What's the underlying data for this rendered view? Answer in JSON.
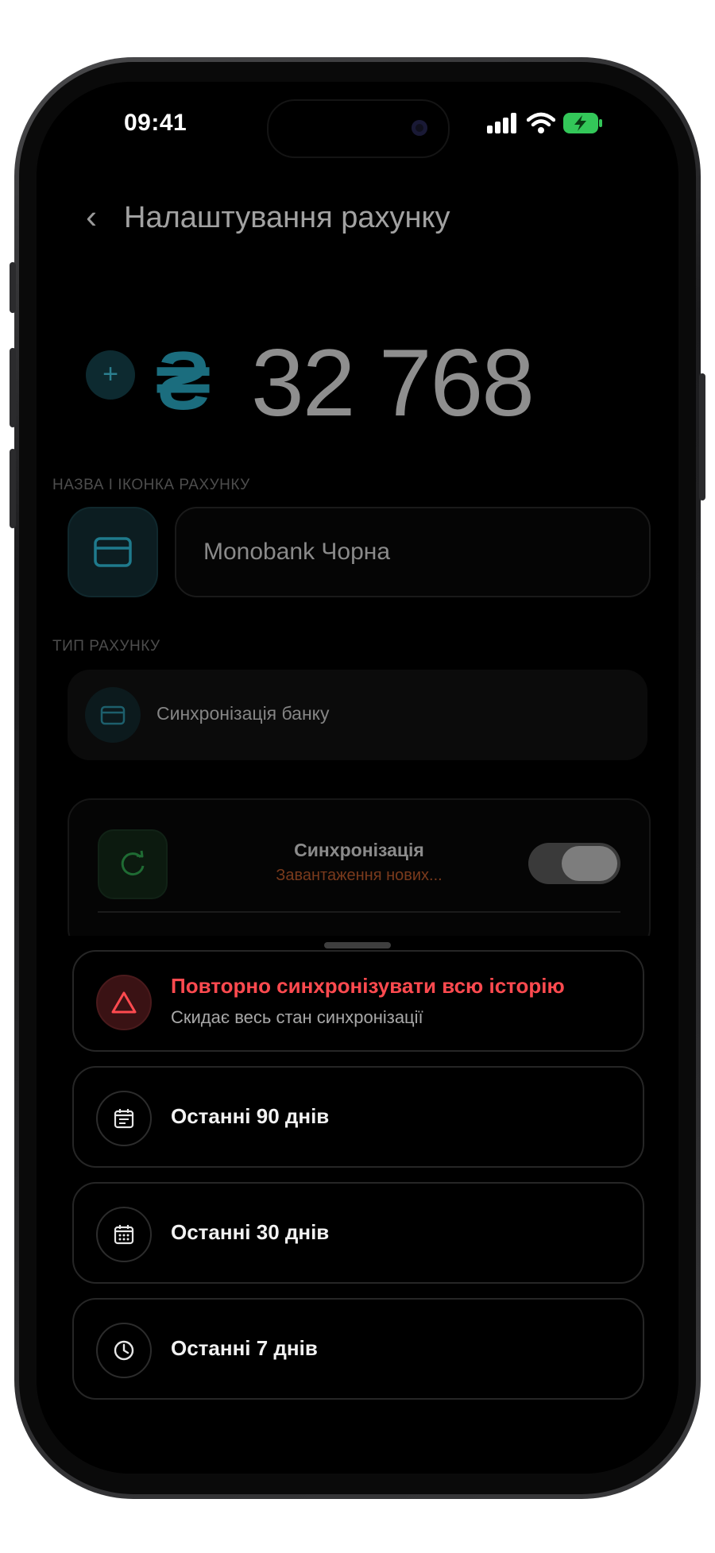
{
  "status": {
    "time": "09:41"
  },
  "header": {
    "title": "Налаштування рахунку"
  },
  "balance": {
    "currency": "₴",
    "amount": "32 768"
  },
  "name_section": {
    "label": "НАЗВА І ІКОНКА РАХУНКУ",
    "value": "Monobank Чорна"
  },
  "type_section": {
    "label": "ТИП РАХУНКУ",
    "value": "Синхронізація банку"
  },
  "sync": {
    "title": "Синхронізація",
    "status": "Завантаження нових...",
    "enabled": true
  },
  "sheet": {
    "options": [
      {
        "label": "Повторно синхронізувати всю історію",
        "sublabel": "Скидає весь стан синхронізації",
        "icon": "warning-triangle-icon"
      },
      {
        "label": "Останні 90 днів",
        "icon": "calendar-list-icon"
      },
      {
        "label": "Останні 30 днів",
        "icon": "calendar-grid-icon"
      },
      {
        "label": "Останні 7 днів",
        "icon": "clock-icon"
      }
    ]
  },
  "colors": {
    "accent": "#1b6d7e",
    "danger": "#ff4a4f",
    "sync_status": "#7a3a1c",
    "background": "#000000"
  }
}
